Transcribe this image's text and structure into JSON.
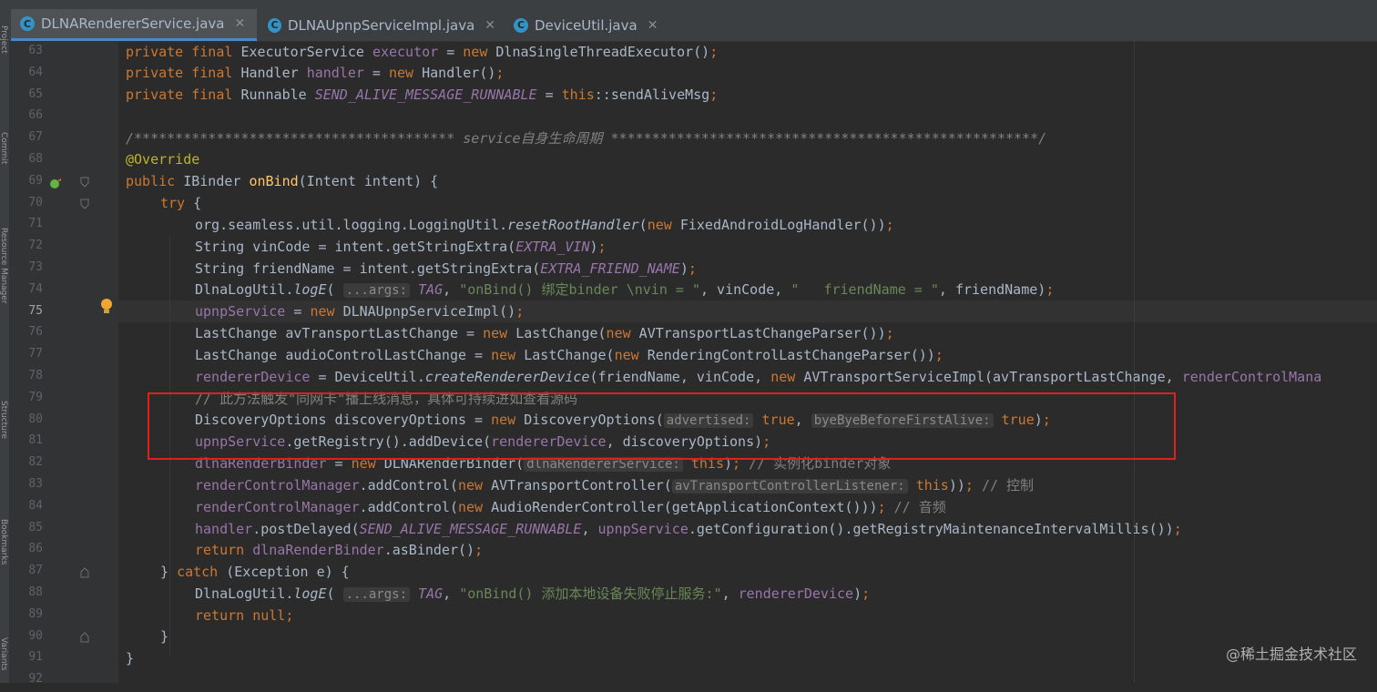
{
  "tabs": [
    {
      "label": "DLNARendererService.java",
      "active": true
    },
    {
      "label": "DLNAUpnpServiceImpl.java",
      "active": false
    },
    {
      "label": "DeviceUtil.java",
      "active": false
    }
  ],
  "left_tool_labels": [
    "Project",
    "Commit",
    "Resource Manager",
    "Structure",
    "Bookmarks",
    "Variants"
  ],
  "current_line": 75,
  "line_numbers": [
    "63",
    "64",
    "65",
    "66",
    "67",
    "68",
    "69",
    "70",
    "71",
    "72",
    "73",
    "74",
    "75",
    "76",
    "77",
    "78",
    "79",
    "80",
    "81",
    "82",
    "83",
    "84",
    "85",
    "86",
    "87",
    "88",
    "89",
    "90",
    "91",
    "92"
  ],
  "watermark": "@稀土掘金技术社区",
  "colors": {
    "keyword": "#cc7832",
    "field": "#9876aa",
    "string": "#6a8759",
    "comment": "#808080",
    "method": "#ffc66d",
    "annotation": "#bbb529",
    "highlight_box": "#e0201a"
  },
  "code": {
    "l63": {
      "a": "private final ",
      "b": "ExecutorService ",
      "c": "executor",
      "d": " = ",
      "e": "new ",
      "f": "DlnaSingleThreadExecutor()",
      "g": ";"
    },
    "l64": {
      "a": "private final ",
      "b": "Handler ",
      "c": "handler",
      "d": " = ",
      "e": "new ",
      "f": "Handler()",
      "g": ";"
    },
    "l65": {
      "a": "private final ",
      "b": "Runnable ",
      "c": "SEND_ALIVE_MESSAGE_RUNNABLE",
      "d": " = ",
      "e": "this",
      "f": "::sendAliveMsg",
      "g": ";"
    },
    "l67": "/*************************************** service自身生命周期 ****************************************************/",
    "l68": "@Override",
    "l69": {
      "a": "public ",
      "b": "IBinder ",
      "c": "onBind",
      "d": "(Intent intent) {"
    },
    "l70": {
      "a": "try ",
      "b": "{"
    },
    "l71": {
      "a": "org.seamless.util.logging.LoggingUtil.",
      "b": "resetRootHandler",
      "c": "(",
      "d": "new ",
      "e": "FixedAndroidLogHandler())",
      "f": ";"
    },
    "l72": {
      "a": "String vinCode = intent.getStringExtra(",
      "b": "EXTRA_VIN",
      "c": ")",
      "d": ";"
    },
    "l73": {
      "a": "String friendName = intent.getStringExtra(",
      "b": "EXTRA_FRIEND_NAME",
      "c": ")",
      "d": ";"
    },
    "l74": {
      "a": "DlnaLogUtil.",
      "b": "logE",
      "c": "( ",
      "hint": "...args:",
      "d": " ",
      "e": "TAG",
      "f": ", ",
      "g": "\"onBind() 绑定binder \\nvin = \"",
      "h": ", vinCode, ",
      "i": "\"   friendName = \"",
      "j": ", friendName)",
      "k": ";"
    },
    "l75": {
      "a": "upnpService",
      "b": " = ",
      "c": "new ",
      "d": "DLNAUpnpServiceImpl()",
      "e": ";"
    },
    "l76": {
      "a": "LastChange avTransportLastChange = ",
      "b": "new ",
      "c": "LastChange(",
      "d": "new ",
      "e": "AVTransportLastChangeParser())",
      "f": ";"
    },
    "l77": {
      "a": "LastChange audioControlLastChange = ",
      "b": "new ",
      "c": "LastChange(",
      "d": "new ",
      "e": "RenderingControlLastChangeParser())",
      "f": ";"
    },
    "l78": {
      "a": "rendererDevice",
      "b": " = DeviceUtil.",
      "c": "createRendererDevice",
      "d": "(friendName, vinCode, ",
      "e": "new ",
      "f": "AVTransportServiceImpl(avTransportLastChange, ",
      "g": "renderControlMana"
    },
    "l79": "// 此方法触发\"同网卡\"播上线消息，具体可持续进如查看源码",
    "l80": {
      "a": "DiscoveryOptions discoveryOptions = ",
      "b": "new ",
      "c": "DiscoveryOptions(",
      "hint1": "advertised:",
      "d": " ",
      "e": "true",
      "f": ", ",
      "hint2": "byeByeBeforeFirstAlive:",
      "g": " ",
      "h": "true",
      "i": ")",
      "j": ";"
    },
    "l81": {
      "a": "upnpService",
      "b": ".getRegistry().addDevice(",
      "c": "rendererDevice",
      "d": ", discoveryOptions)",
      "e": ";"
    },
    "l82": {
      "a": "dlnaRenderBinder",
      "b": " = ",
      "c": "new ",
      "d": "DLNARenderBinder(",
      "hint": "dlnaRendererService:",
      "e": " ",
      "f": "this",
      "g": ")",
      "h": ";",
      "i": " // 实例化binder对象"
    },
    "l83": {
      "a": "renderControlManager",
      "b": ".addControl(",
      "c": "new ",
      "d": "AVTransportController(",
      "hint": "avTransportControllerListener:",
      "e": " ",
      "f": "this",
      "g": "))",
      "h": ";",
      "i": " // 控制"
    },
    "l84": {
      "a": "renderControlManager",
      "b": ".addControl(",
      "c": "new ",
      "d": "AudioRenderController(getApplicationContext()))",
      "e": ";",
      "f": " // 音频"
    },
    "l85": {
      "a": "handler",
      "b": ".postDelayed(",
      "c": "SEND_ALIVE_MESSAGE_RUNNABLE",
      "d": ", ",
      "e": "upnpService",
      "f": ".getConfiguration().getRegistryMaintenanceIntervalMillis())",
      "g": ";"
    },
    "l86": {
      "a": "return ",
      "b": "dlnaRenderBinder",
      "c": ".asBinder()",
      "d": ";"
    },
    "l87": {
      "a": "} ",
      "b": "catch ",
      "c": "(Exception e) {"
    },
    "l88": {
      "a": "DlnaLogUtil.",
      "b": "logE",
      "c": "( ",
      "hint": "...args:",
      "d": " ",
      "e": "TAG",
      "f": ", ",
      "g": "\"onBind() 添加本地设备失败停止服务:\"",
      "h": ", ",
      "i": "rendererDevice",
      "j": ")",
      "k": ";"
    },
    "l89": {
      "a": "return ",
      "b": "null",
      "c": ";"
    },
    "l90": "}",
    "l91": "}"
  }
}
